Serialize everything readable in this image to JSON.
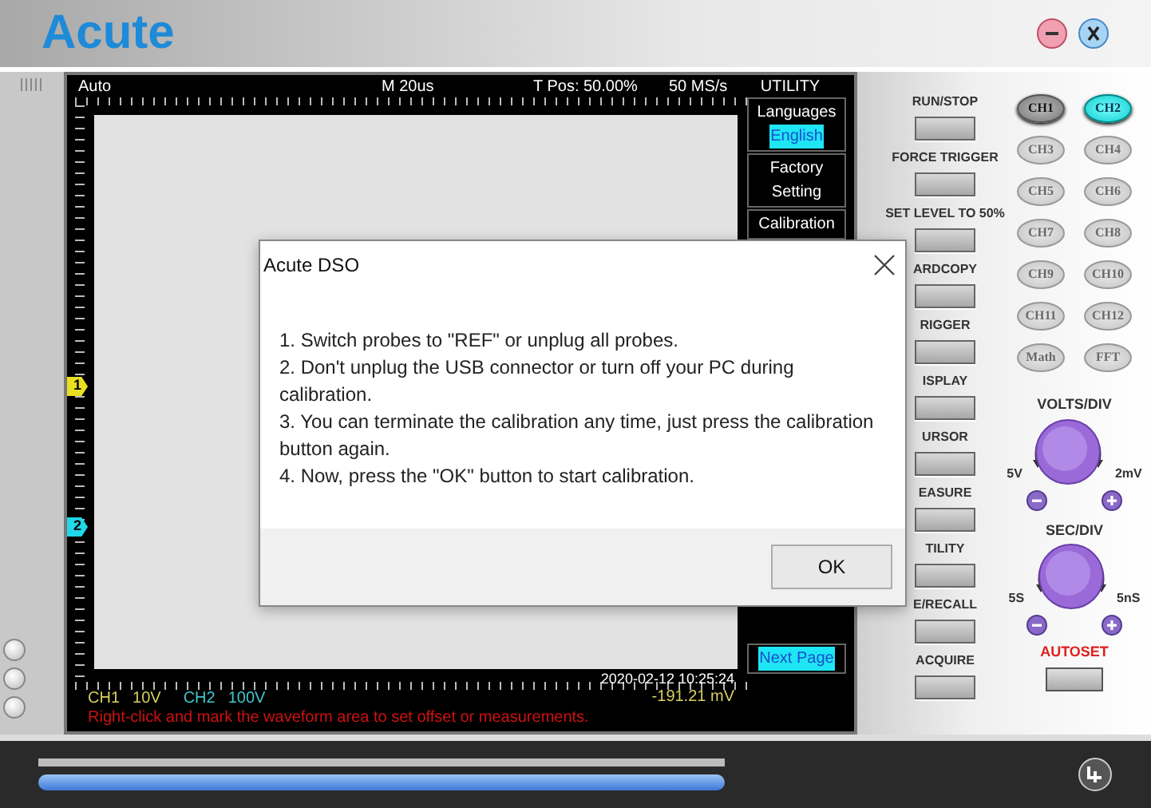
{
  "app": {
    "logo": "Acute"
  },
  "scope": {
    "mode": "Auto",
    "timebase": "M 20us",
    "trigger_position": "T Pos: 50.00%",
    "sample_rate": "50 MS/s",
    "menu_title": "UTILITY",
    "menu_groups": [
      {
        "items": [
          {
            "text": "Languages",
            "highlighted": false
          },
          {
            "text": "English",
            "highlighted": true
          }
        ]
      },
      {
        "items": [
          {
            "text": "Factory",
            "highlighted": false
          },
          {
            "text": "Setting",
            "highlighted": false
          }
        ]
      },
      {
        "items": [
          {
            "text": "Calibration",
            "highlighted": false
          }
        ]
      },
      {
        "items": [
          {
            "text": "Next Page",
            "highlighted": true
          }
        ]
      }
    ],
    "markers": [
      {
        "label": "1",
        "color": "#e8e020"
      },
      {
        "label": "2",
        "color": "#20d8e8"
      }
    ],
    "timestamp": "2020-02-12 10:25:24",
    "channels": [
      {
        "name": "CH1",
        "scale": "10V",
        "color": "#d8d060"
      },
      {
        "name": "CH2",
        "scale": "100V",
        "color": "#40c8d0"
      }
    ],
    "reading": "-191.21 mV",
    "hint": "Right-click and mark the waveform area to set offset or measurements."
  },
  "controls": [
    {
      "label": "RUN/STOP"
    },
    {
      "label": "FORCE TRIGGER"
    },
    {
      "label": "SET LEVEL TO 50%"
    },
    {
      "label": "ARDCOPY"
    },
    {
      "label": "RIGGER"
    },
    {
      "label": "ISPLAY"
    },
    {
      "label": "URSOR"
    },
    {
      "label": "EASURE"
    },
    {
      "label": "TILITY"
    },
    {
      "label": "E/RECALL"
    },
    {
      "label": "ACQUIRE"
    }
  ],
  "channel_buttons": [
    {
      "label": "CH1",
      "selected": false,
      "disabled": false
    },
    {
      "label": "CH2",
      "selected": true,
      "disabled": false
    },
    {
      "label": "CH3",
      "selected": false,
      "disabled": true
    },
    {
      "label": "CH4",
      "selected": false,
      "disabled": true
    },
    {
      "label": "CH5",
      "selected": false,
      "disabled": true
    },
    {
      "label": "CH6",
      "selected": false,
      "disabled": true
    },
    {
      "label": "CH7",
      "selected": false,
      "disabled": true
    },
    {
      "label": "CH8",
      "selected": false,
      "disabled": true
    },
    {
      "label": "CH9",
      "selected": false,
      "disabled": true
    },
    {
      "label": "CH10",
      "selected": false,
      "disabled": true
    },
    {
      "label": "CH11",
      "selected": false,
      "disabled": true
    },
    {
      "label": "CH12",
      "selected": false,
      "disabled": true
    },
    {
      "label": "Math",
      "selected": false,
      "disabled": true
    },
    {
      "label": "FFT",
      "selected": false,
      "disabled": true
    }
  ],
  "knobs": [
    {
      "title": "VOLTS/DIV",
      "min": "5V",
      "max": "2mV"
    },
    {
      "title": "SEC/DIV",
      "min": "5S",
      "max": "5nS"
    }
  ],
  "autoset": {
    "label": "AUTOSET"
  },
  "progress": {
    "level": 1
  },
  "dialog": {
    "title": "Acute DSO",
    "lines": [
      "1. Switch probes to \"REF\" or unplug all probes.",
      "2. Don't unplug the USB connector or turn off your PC during calibration.",
      "3. You can terminate the calibration any time, just press the calibration button again.",
      "4. Now, press the \"OK\" button to start calibration."
    ],
    "ok": "OK"
  }
}
